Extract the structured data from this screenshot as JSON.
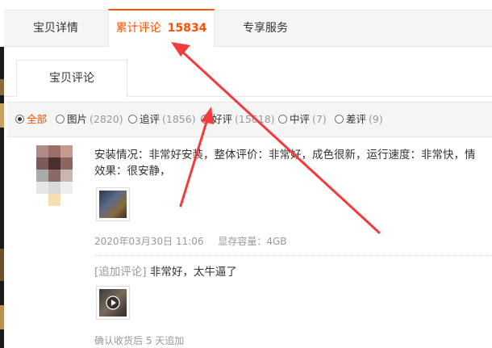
{
  "tabs": [
    {
      "label": "宝贝详情"
    },
    {
      "label": "累计评论",
      "count": "15834"
    },
    {
      "label": "专享服务"
    }
  ],
  "subtab": {
    "label": "宝贝评论"
  },
  "filters": [
    {
      "label": "全部",
      "count": ""
    },
    {
      "label": "图片",
      "count": "(2820)"
    },
    {
      "label": "追评",
      "count": "(1856)"
    },
    {
      "label": "好评",
      "count": "(15618)"
    },
    {
      "label": "中评",
      "count": "(7)"
    },
    {
      "label": "差评",
      "count": "(9)"
    }
  ],
  "review": {
    "line1": "安装情况：非常好安装，整体评价：非常好，成色很新，运行速度：非常快，情",
    "line2": "效果：很安静，",
    "date": "2020年03月30日 11:06",
    "spec": "显存容量：4GB",
    "append_tag": "[追加评论]",
    "append_text": "非常好，太牛逼了",
    "append_note": "确认收货后 5 天追加"
  },
  "colors": {
    "accent": "#ff5000",
    "arrow": "#f03c3c"
  }
}
